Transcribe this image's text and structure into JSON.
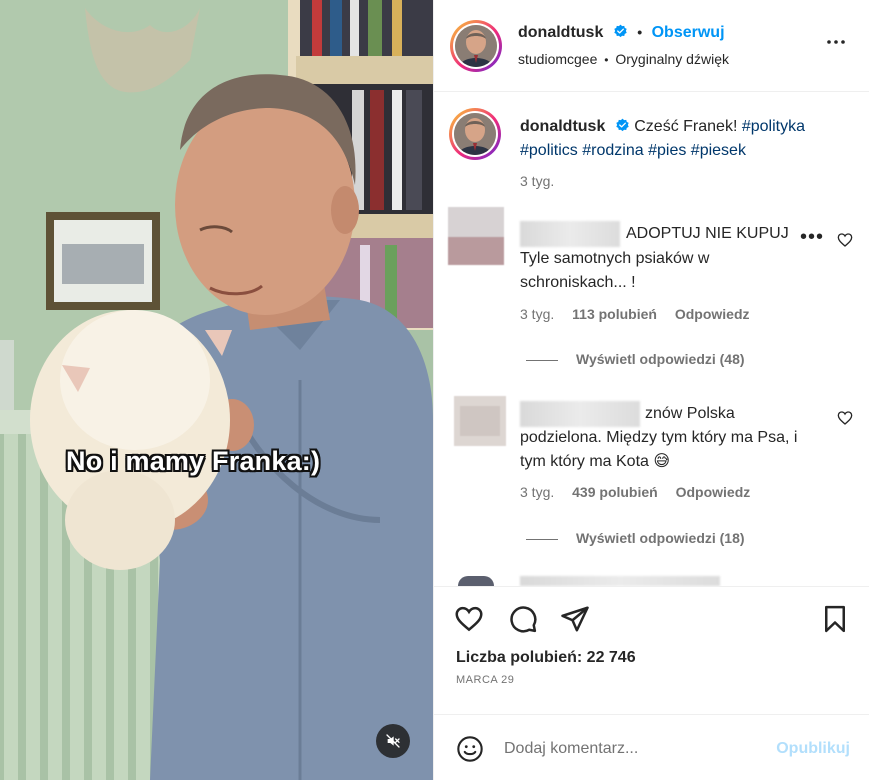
{
  "video": {
    "caption_overlay": "No i mamy Franka:)",
    "mute_icon": "speaker-muted-icon"
  },
  "header": {
    "username": "donaldtusk",
    "follow_label": "Obserwuj",
    "separator": "•",
    "audio_author": "studiomcgee",
    "audio_label": "Oryginalny dźwięk",
    "more_icon": "ellipsis-icon"
  },
  "post_caption": {
    "username": "donaldtusk",
    "text": "Cześć Franek!",
    "hashtags": [
      "#polityka",
      "#politics",
      "#rodzina",
      "#pies",
      "#piesek"
    ],
    "time": "3 tyg."
  },
  "comments": [
    {
      "text_line1": "ADOPTUJ NIE KUPUJ",
      "text_rest": "Tyle samotnych psiaków w schroniskach... !",
      "time": "3 tyg.",
      "likes": "113 polubień",
      "reply_label": "Odpowiedz",
      "view_replies": "Wyświetl odpowiedzi (48)"
    },
    {
      "text_line1": "znów Polska",
      "text_rest": "podzielona. Między tym który ma Psa, i tym który ma Kota 😅",
      "time": "3 tyg.",
      "likes": "439 polubień",
      "reply_label": "Odpowiedz",
      "view_replies": "Wyświetl odpowiedzi (18)"
    }
  ],
  "actions": {
    "like_icon": "heart-icon",
    "comment_icon": "comment-bubble-icon",
    "share_icon": "paper-plane-icon",
    "save_icon": "bookmark-icon",
    "likes_text": "Liczba polubień: 22 746",
    "date": "MARCA 29"
  },
  "add_comment": {
    "emoji_icon": "emoji-smile-icon",
    "placeholder": "Dodaj komentarz...",
    "publish_label": "Opublikuj"
  },
  "colors": {
    "accent": "#0095f6",
    "hashtag": "#00376b",
    "muted": "#737373",
    "publish_disabled": "#b2dffc"
  }
}
